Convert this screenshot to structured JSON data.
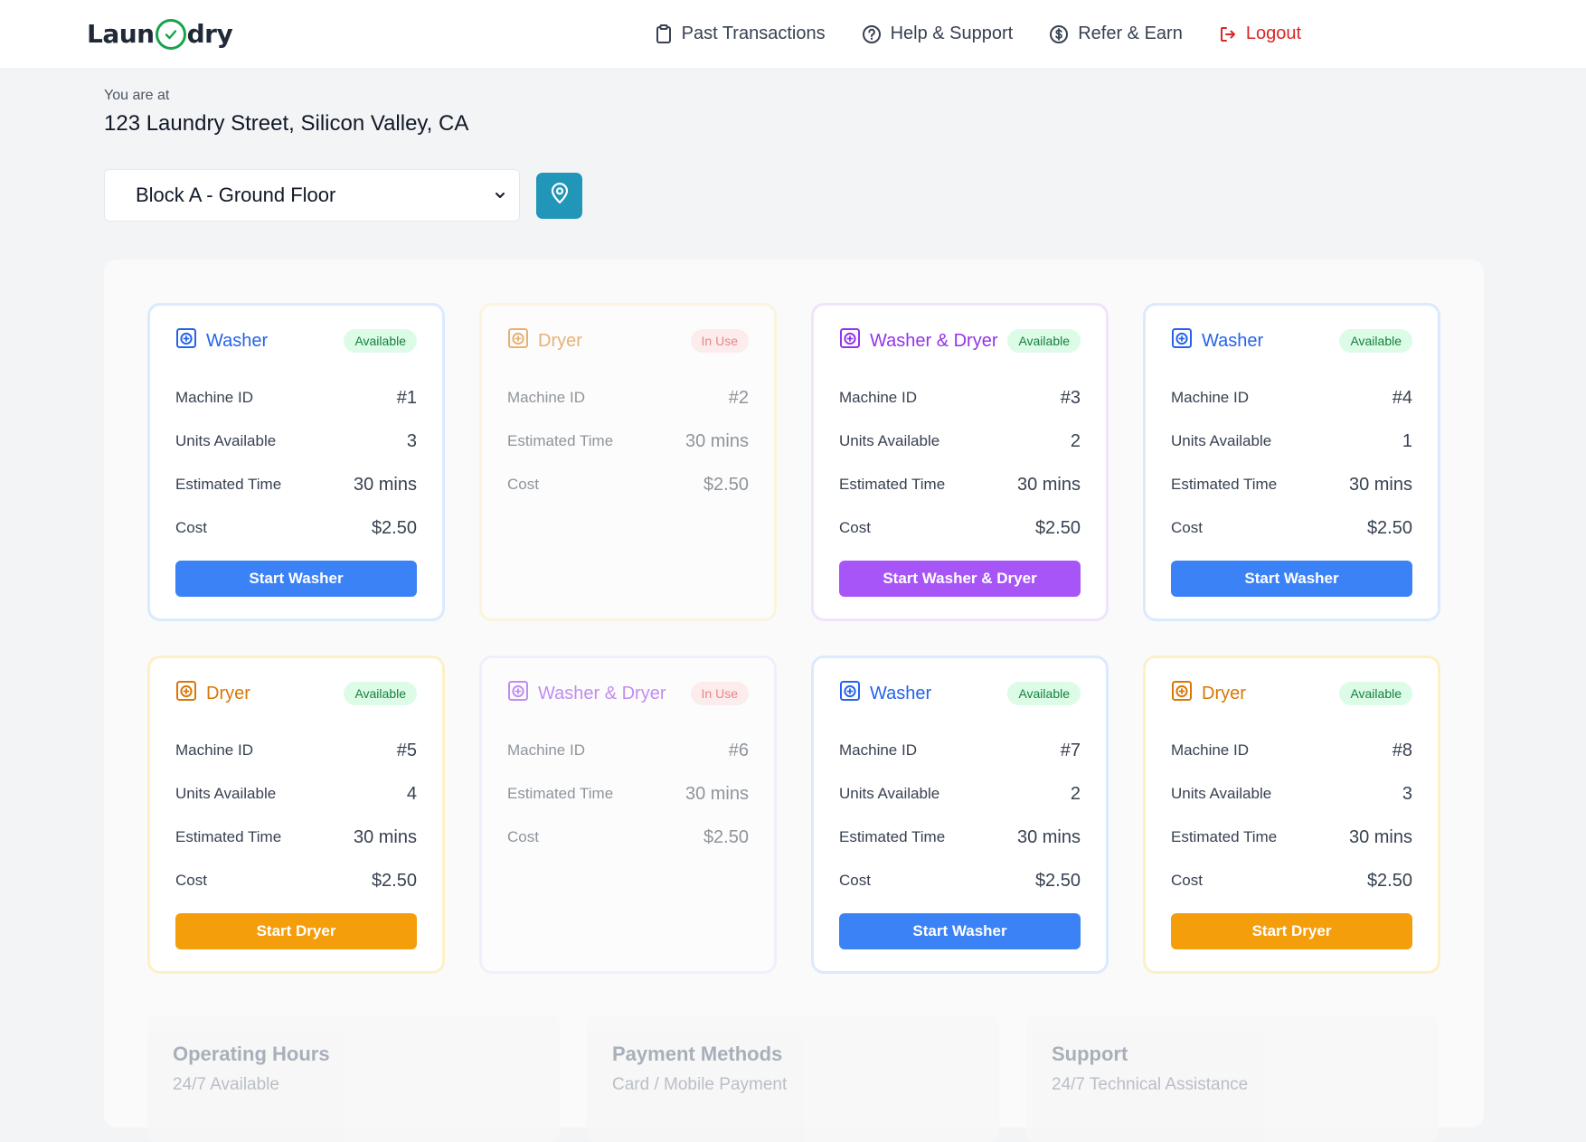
{
  "header": {
    "logo_left": "Laun",
    "logo_right": "dry",
    "nav": [
      {
        "label": "Past Transactions",
        "icon": "clipboard-icon"
      },
      {
        "label": "Help & Support",
        "icon": "help-icon"
      },
      {
        "label": "Refer & Earn",
        "icon": "dollar-icon"
      },
      {
        "label": "Logout",
        "icon": "logout-icon"
      }
    ]
  },
  "location": {
    "caption": "You are at",
    "address": "123 Laundry Street, Silicon Valley, CA",
    "block": "Block A - Ground Floor"
  },
  "machines": [
    {
      "type": "washer",
      "title": "Washer",
      "status": "Available",
      "rows": [
        {
          "label": "Machine ID",
          "value": "#1"
        },
        {
          "label": "Units Available",
          "value": "3"
        },
        {
          "label": "Estimated Time",
          "value": "30 mins"
        },
        {
          "label": "Cost",
          "value": "$2.50"
        }
      ],
      "button": "Start Washer"
    },
    {
      "type": "dryer",
      "title": "Dryer",
      "status": "In Use",
      "rows": [
        {
          "label": "Machine ID",
          "value": "#2"
        },
        {
          "label": "Estimated Time",
          "value": "30 mins"
        },
        {
          "label": "Cost",
          "value": "$2.50"
        }
      ],
      "button": ""
    },
    {
      "type": "combo",
      "title": "Washer & Dryer",
      "status": "Available",
      "rows": [
        {
          "label": "Machine ID",
          "value": "#3"
        },
        {
          "label": "Units Available",
          "value": "2"
        },
        {
          "label": "Estimated Time",
          "value": "30 mins"
        },
        {
          "label": "Cost",
          "value": "$2.50"
        }
      ],
      "button": "Start Washer & Dryer"
    },
    {
      "type": "washer",
      "title": "Washer",
      "status": "Available",
      "rows": [
        {
          "label": "Machine ID",
          "value": "#4"
        },
        {
          "label": "Units Available",
          "value": "1"
        },
        {
          "label": "Estimated Time",
          "value": "30 mins"
        },
        {
          "label": "Cost",
          "value": "$2.50"
        }
      ],
      "button": "Start Washer"
    },
    {
      "type": "dryer",
      "title": "Dryer",
      "status": "Available",
      "rows": [
        {
          "label": "Machine ID",
          "value": "#5"
        },
        {
          "label": "Units Available",
          "value": "4"
        },
        {
          "label": "Estimated Time",
          "value": "30 mins"
        },
        {
          "label": "Cost",
          "value": "$2.50"
        }
      ],
      "button": "Start Dryer"
    },
    {
      "type": "combo",
      "title": "Washer & Dryer",
      "status": "In Use",
      "rows": [
        {
          "label": "Machine ID",
          "value": "#6"
        },
        {
          "label": "Estimated Time",
          "value": "30 mins"
        },
        {
          "label": "Cost",
          "value": "$2.50"
        }
      ],
      "button": ""
    },
    {
      "type": "washer",
      "title": "Washer",
      "status": "Available",
      "rows": [
        {
          "label": "Machine ID",
          "value": "#7"
        },
        {
          "label": "Units Available",
          "value": "2"
        },
        {
          "label": "Estimated Time",
          "value": "30 mins"
        },
        {
          "label": "Cost",
          "value": "$2.50"
        }
      ],
      "button": "Start Washer"
    },
    {
      "type": "dryer",
      "title": "Dryer",
      "status": "Available",
      "rows": [
        {
          "label": "Machine ID",
          "value": "#8"
        },
        {
          "label": "Units Available",
          "value": "3"
        },
        {
          "label": "Estimated Time",
          "value": "30 mins"
        },
        {
          "label": "Cost",
          "value": "$2.50"
        }
      ],
      "button": "Start Dryer"
    }
  ],
  "info": [
    {
      "title": "Operating Hours",
      "subtitle": "24/7 Available"
    },
    {
      "title": "Payment Methods",
      "subtitle": "Card / Mobile Payment"
    },
    {
      "title": "Support",
      "subtitle": "24/7 Technical Assistance"
    }
  ],
  "colors": {
    "washer": "#2563eb",
    "dryer": "#d97706",
    "combo": "#9333ea",
    "location_button": "#2196b8",
    "logout": "#dc2626",
    "logo_check": "#16a34a"
  }
}
